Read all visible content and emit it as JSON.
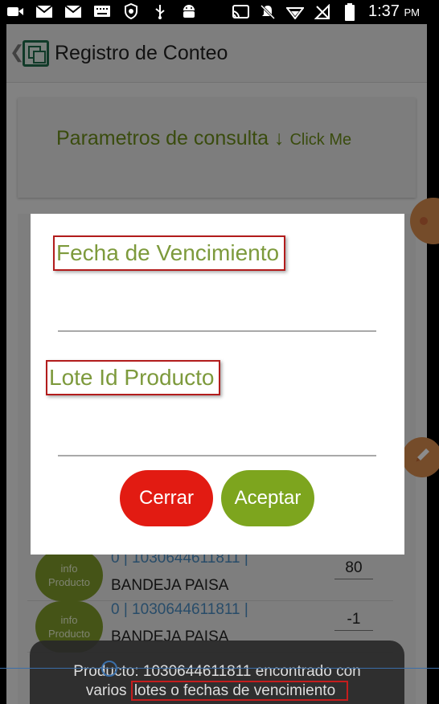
{
  "status_bar": {
    "time": "1:37",
    "ampm": "PM",
    "left_icons": [
      "video-icon",
      "mail-icon",
      "mail-icon",
      "keyboard-icon",
      "shield-icon",
      "usb-icon",
      "android-icon"
    ],
    "right_icons": [
      "cast-icon",
      "notifications-off-icon",
      "wifi-icon",
      "no-signal-icon",
      "battery-icon"
    ]
  },
  "toolbar": {
    "title": "Registro de Conteo"
  },
  "params": {
    "label": "Parametros de consulta ↓",
    "click": "Click Me"
  },
  "list": {
    "info_label_1": "info",
    "info_label_2": "Producto",
    "rows": [
      {
        "code": "0 | 1030644611811 |",
        "name": "BANDEJA PAISA",
        "qty": "80"
      },
      {
        "code": "0 | 1030644611811 |",
        "name": "BANDEJA PAISA",
        "qty": "-1"
      }
    ]
  },
  "dialog": {
    "fecha_label": "Fecha de Vencimiento",
    "fecha_value": "",
    "lote_label": "Lote Id Producto",
    "lote_value": "",
    "cerrar": "Cerrar",
    "aceptar": "Aceptar"
  },
  "toast": {
    "line1": "Producto: 1030644611811 encontrado con",
    "line2_prefix": "varios",
    "line2_highlight": "lotes o fechas de vencimiento"
  },
  "colors": {
    "accent_green": "#7da51e",
    "cerrar_red": "#e21b12",
    "label_green": "#7d9a3c",
    "highlight_border": "#b21c1c"
  }
}
